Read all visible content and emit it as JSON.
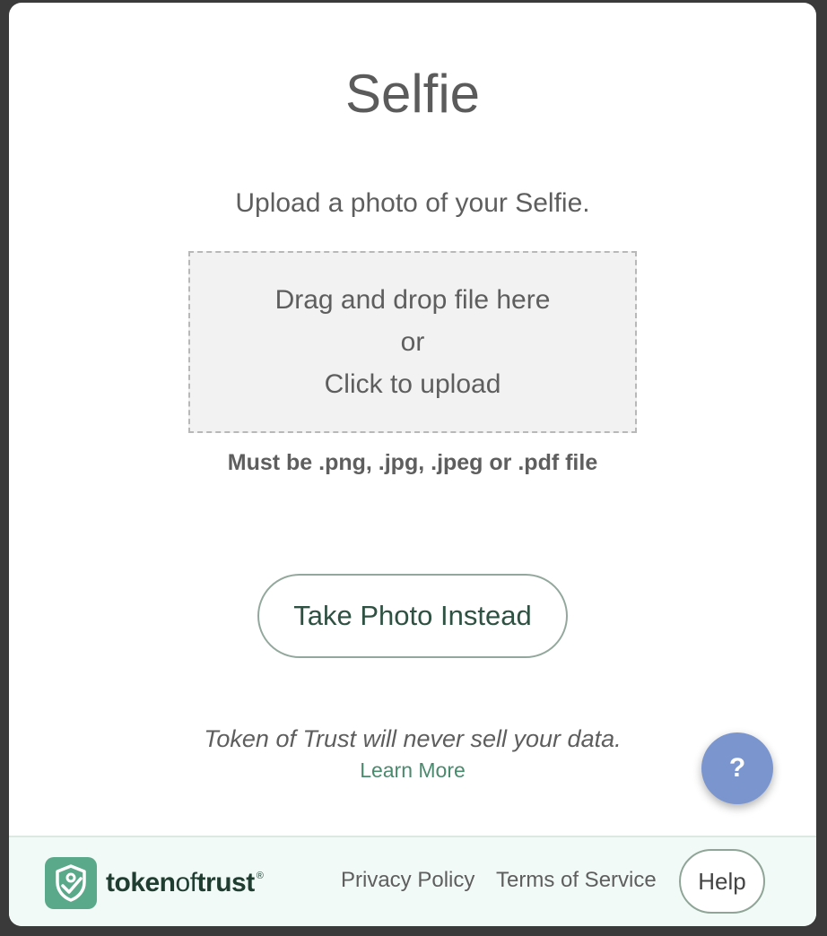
{
  "page": {
    "title": "Selfie",
    "subtitle": "Upload a photo of your Selfie."
  },
  "dropzone": {
    "line1": "Drag and drop file here",
    "line2": "or",
    "line3": "Click to upload"
  },
  "hint": "Must be .png, .jpg, .jpeg or .pdf file",
  "take_photo_label": "Take Photo Instead",
  "privacy_note": "Token of Trust will never sell your data.",
  "learn_more_label": "Learn More",
  "fab": {
    "label": "?",
    "color": "#7b96cf"
  },
  "footer": {
    "brand": {
      "part1": "token",
      "part2": "of",
      "part3": "trust",
      "registered": "®",
      "logo_icon": "shield-check-icon",
      "logo_color": "#5ba98b"
    },
    "privacy_policy_label": "Privacy Policy",
    "terms_label": "Terms of Service",
    "help_label": "Help"
  },
  "colors": {
    "accent_green": "#2f5143",
    "link_green": "#4a8a6e",
    "footer_bg": "#f2faf7"
  }
}
